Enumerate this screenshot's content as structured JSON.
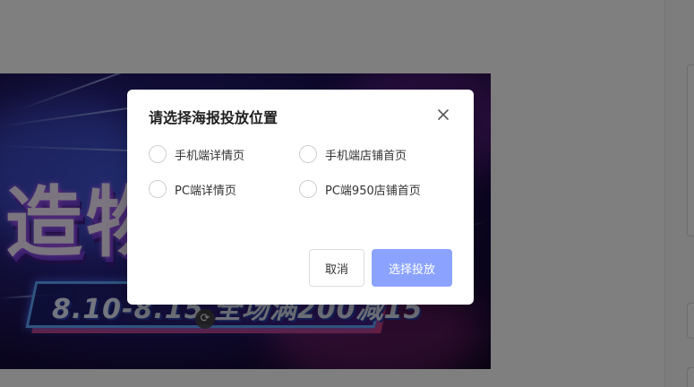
{
  "poster": {
    "headline": "造物",
    "date_text": "8.10-8.15 全场满200减15"
  },
  "dialog": {
    "title": "请选择海报投放位置",
    "options": [
      {
        "label": "手机端详情页",
        "checked": false
      },
      {
        "label": "手机端店铺首页",
        "checked": false
      },
      {
        "label": "PC端详情页",
        "checked": false
      },
      {
        "label": "PC端950店铺首页",
        "checked": false
      }
    ],
    "cancel_label": "取消",
    "confirm_label": "选择投放",
    "confirm_color": "#8ba3ff"
  },
  "icons": {
    "close": "close-icon",
    "refresh": "refresh-icon"
  }
}
